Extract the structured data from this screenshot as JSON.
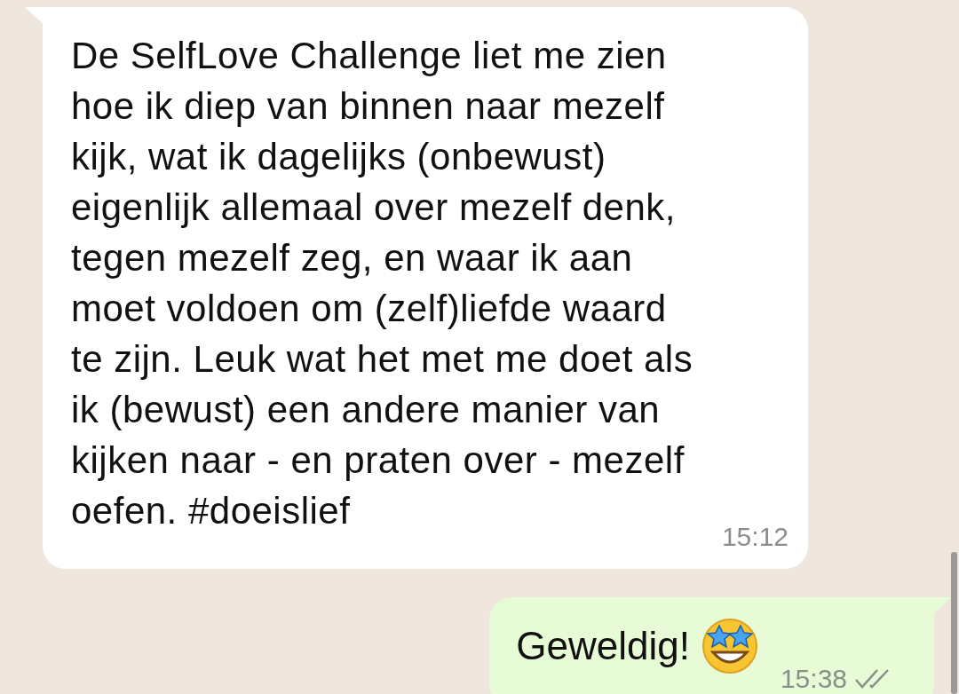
{
  "messages": [
    {
      "kind": "incoming",
      "lines": [
        "De SelfLove Challenge liet me zien",
        "hoe ik diep van binnen naar mezelf",
        "kijk, wat ik dagelijks (onbewust)",
        "eigenlijk allemaal over mezelf denk,",
        "tegen mezelf zeg, en waar ik aan",
        "moet voldoen om (zelf)liefde waard",
        "te zijn. Leuk wat het met me doet als",
        "ik (bewust) een andere manier van",
        "kijken naar - en praten over - mezelf",
        "oefen. #doeislief"
      ],
      "time": "15:12"
    },
    {
      "kind": "outgoing",
      "text": "Geweldig!",
      "emoji": true,
      "time": "15:38",
      "read": false
    }
  ]
}
